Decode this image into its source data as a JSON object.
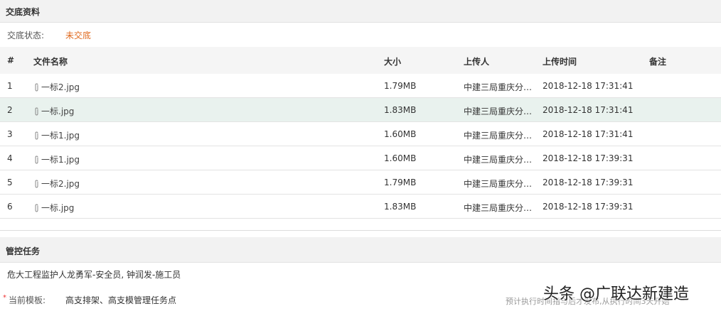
{
  "handover": {
    "title": "交底资料",
    "status_label": "交底状态:",
    "status_value": "未交底",
    "status_color": "#e06a1e",
    "columns": [
      "#",
      "文件名称",
      "大小",
      "上传人",
      "上传时间",
      "备注"
    ],
    "rows": [
      {
        "idx": "1",
        "name": "一标2.jpg",
        "size": "1.79MB",
        "uploader": "中建三局重庆分…",
        "time": "2018-12-18 17:31:41",
        "note": ""
      },
      {
        "idx": "2",
        "name": "一标.jpg",
        "size": "1.83MB",
        "uploader": "中建三局重庆分…",
        "time": "2018-12-18 17:31:41",
        "note": ""
      },
      {
        "idx": "3",
        "name": "一标1.jpg",
        "size": "1.60MB",
        "uploader": "中建三局重庆分…",
        "time": "2018-12-18 17:31:41",
        "note": ""
      },
      {
        "idx": "4",
        "name": "一标1.jpg",
        "size": "1.60MB",
        "uploader": "中建三局重庆分…",
        "time": "2018-12-18 17:39:31",
        "note": ""
      },
      {
        "idx": "5",
        "name": "一标2.jpg",
        "size": "1.79MB",
        "uploader": "中建三局重庆分…",
        "time": "2018-12-18 17:39:31",
        "note": ""
      },
      {
        "idx": "6",
        "name": "一标.jpg",
        "size": "1.83MB",
        "uploader": "中建三局重庆分…",
        "time": "2018-12-18 17:39:31",
        "note": ""
      }
    ],
    "highlight_row_color": "#e9f2ee",
    "attachment_icon": "paperclip-icon"
  },
  "control": {
    "title": "管控任务",
    "workers": "危大工程监护人龙勇军-安全员, 钟润发-施工员",
    "required_mark": "*",
    "template_label": "当前模板:",
    "template_value": "高支排架、高支模管理任务点",
    "template_note": "预计执行时间指与后才发布,从执行时间3天开始"
  },
  "watermark": "头条 @广联达新建造"
}
